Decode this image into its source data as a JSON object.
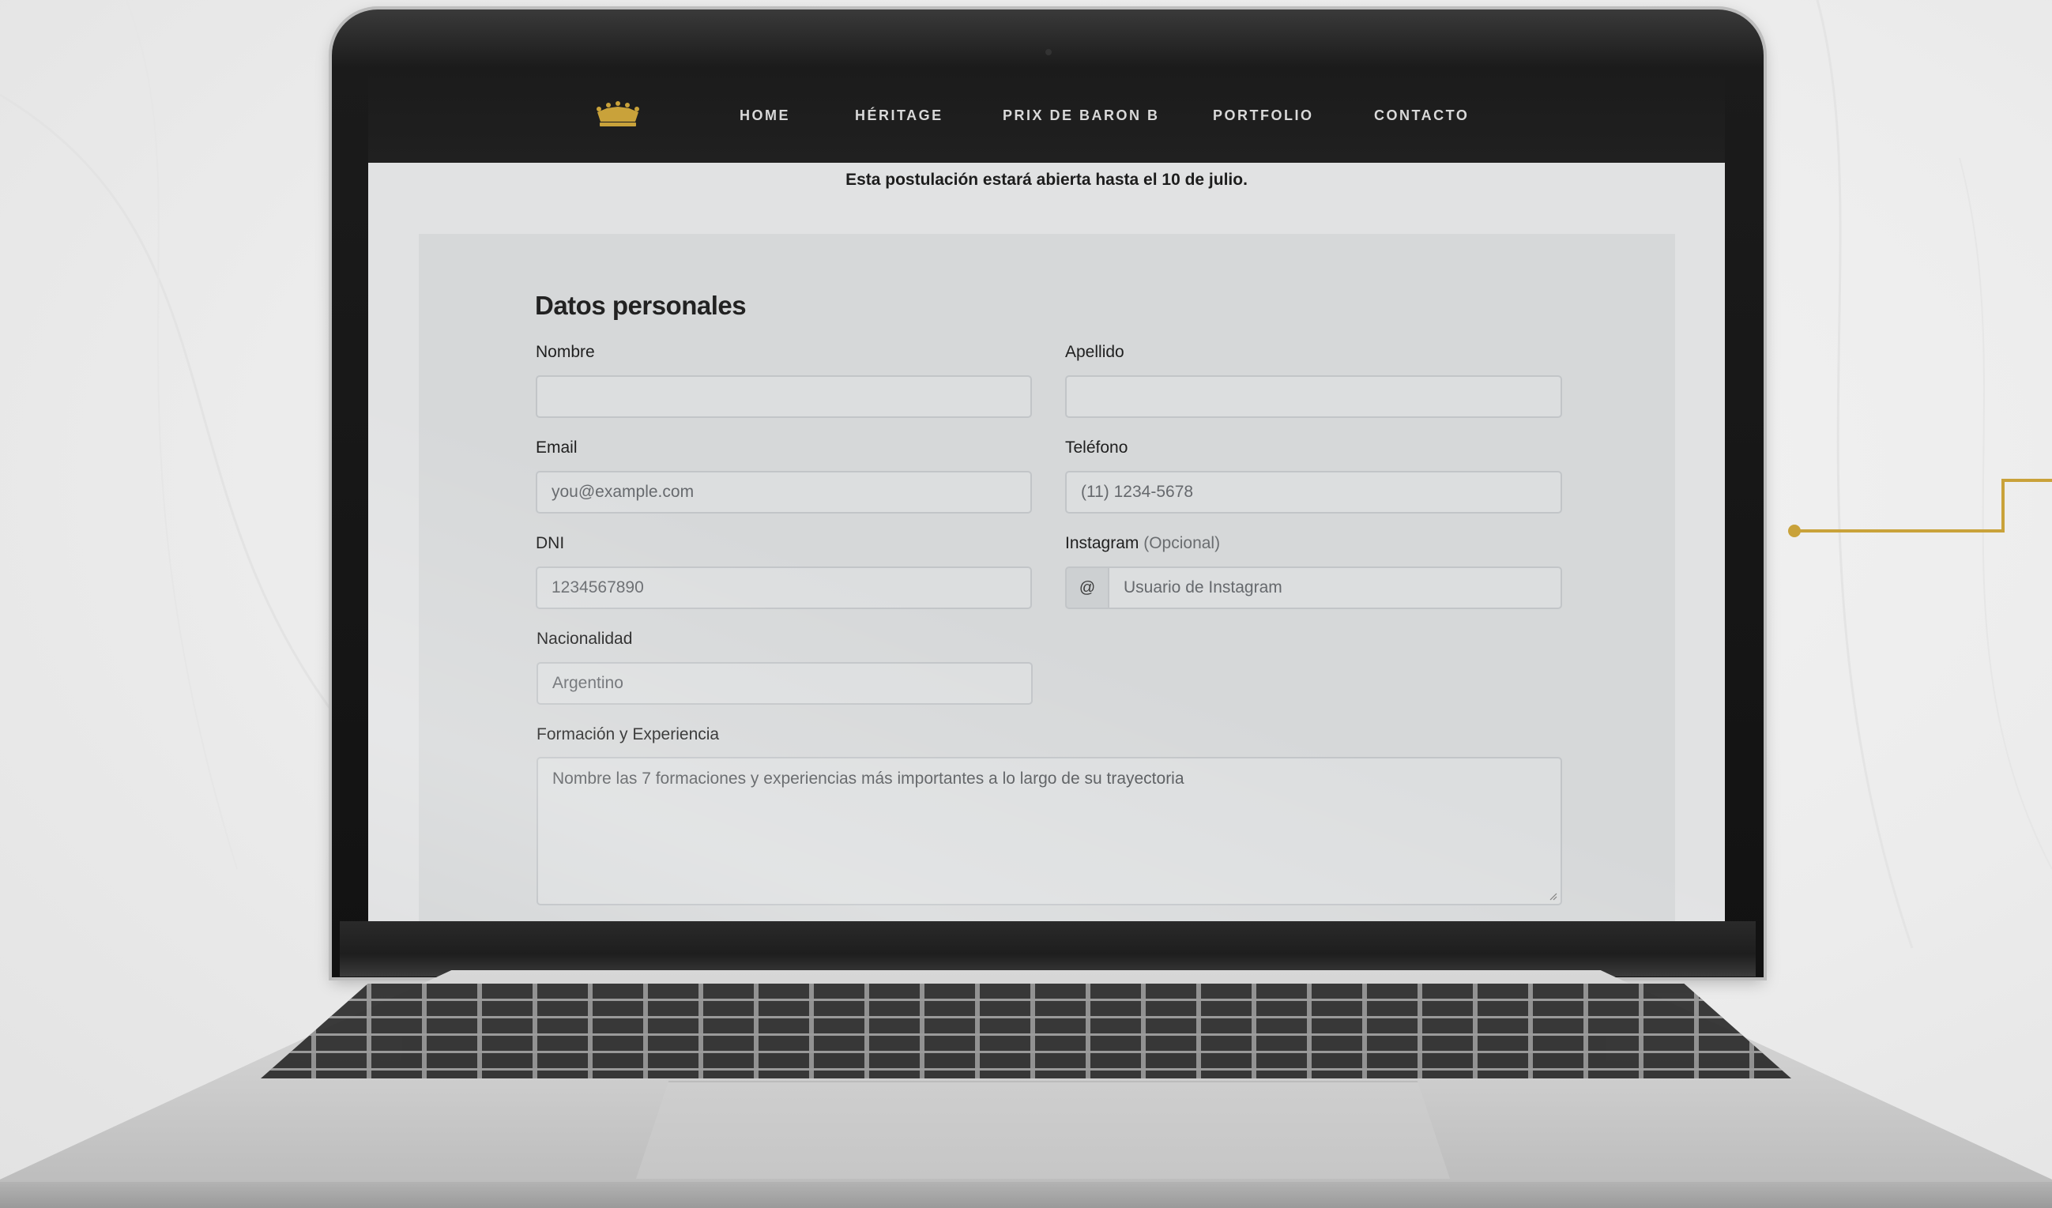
{
  "nav": {
    "items": [
      "HOME",
      "HÉRITAGE",
      "PRIX DE BARON B",
      "PORTFOLIO",
      "CONTACTO"
    ]
  },
  "notice": "Esta postulación estará abierta hasta el 10 de julio.",
  "form": {
    "title": "Datos personales",
    "nombre": {
      "label": "Nombre",
      "placeholder": ""
    },
    "apellido": {
      "label": "Apellido",
      "placeholder": ""
    },
    "email": {
      "label": "Email",
      "placeholder": "you@example.com"
    },
    "telefono": {
      "label": "Teléfono",
      "placeholder": "(11) 1234-5678"
    },
    "dni": {
      "label": "DNI",
      "placeholder": "1234567890"
    },
    "instagram": {
      "label": "Instagram",
      "optional": "(Opcional)",
      "prefix": "@",
      "placeholder": "Usuario de Instagram"
    },
    "nacionalidad": {
      "label": "Nacionalidad",
      "placeholder": "Argentino"
    },
    "formacion": {
      "label": "Formación y Experiencia",
      "placeholder": "Nombre las 7 formaciones y experiencias más importantes a lo largo de su trayectoria"
    }
  },
  "colors": {
    "accent_gold": "#c9a23a",
    "nav_bg": "#1b1b1b"
  },
  "icons": {
    "logo": "crown-icon"
  }
}
